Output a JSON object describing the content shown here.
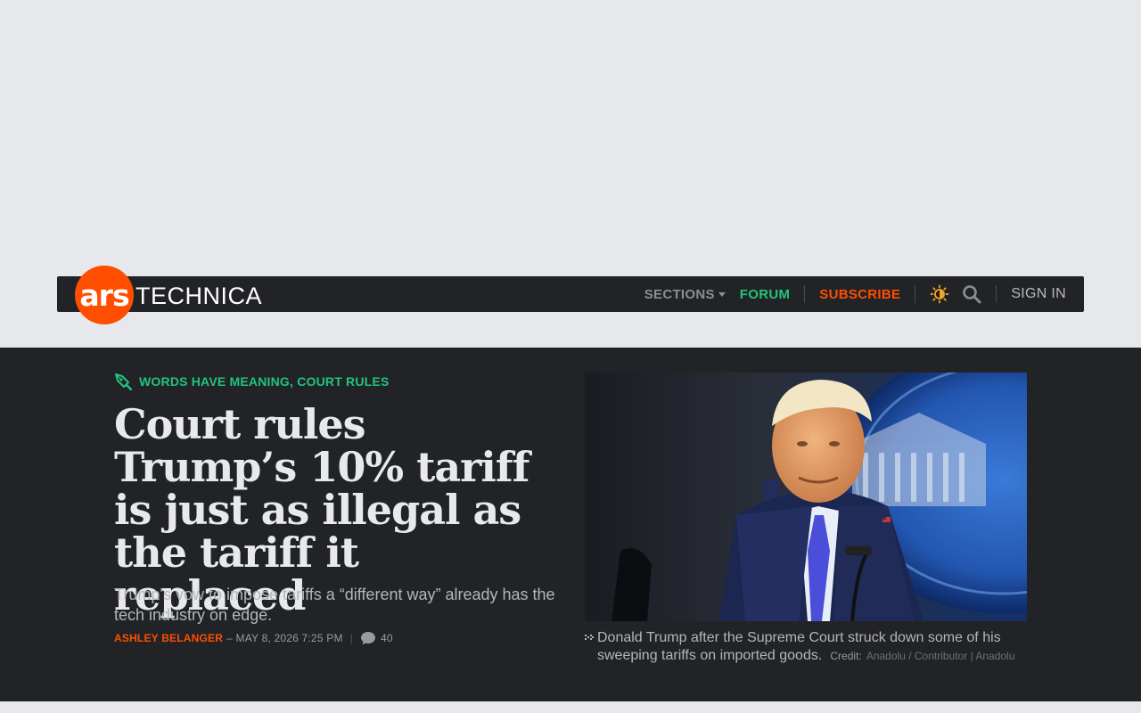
{
  "site": {
    "logo_ars": "ars",
    "logo_technica": "TECHNICA"
  },
  "nav": {
    "sections": "SECTIONS",
    "forum": "FORUM",
    "subscribe": "SUBSCRIBE",
    "signin": "SIGN IN"
  },
  "article": {
    "kicker": "WORDS HAVE MEANING, COURT RULES",
    "headline": "Court rules Trump’s 10% tariff is just as illegal as the tariff it replaced",
    "dek": "Trump’s vow to impose tariffs a “different way” already has the tech industry on edge.",
    "author": "ASHLEY BELANGER",
    "date": "– MAY 8, 2026 7:25 PM",
    "separator": "|",
    "comment_count": "40"
  },
  "image": {
    "caption": "Donald Trump after the Supreme Court struck down some of his sweeping tariffs on imported goods.",
    "credit_label": "Credit:",
    "credit": "Anadolu / Contributor | Anadolu"
  },
  "colors": {
    "brand_orange": "#ff4e00",
    "accent_green": "#22c47a",
    "nav_bg": "#222327",
    "page_bg": "#e7e8ec"
  },
  "icons": {
    "theme_toggle": "sun-icon",
    "search": "search-icon",
    "comments": "comment-bubble-icon",
    "kicker": "pen-nib-icon",
    "caption": "caption-arrow-icon"
  }
}
